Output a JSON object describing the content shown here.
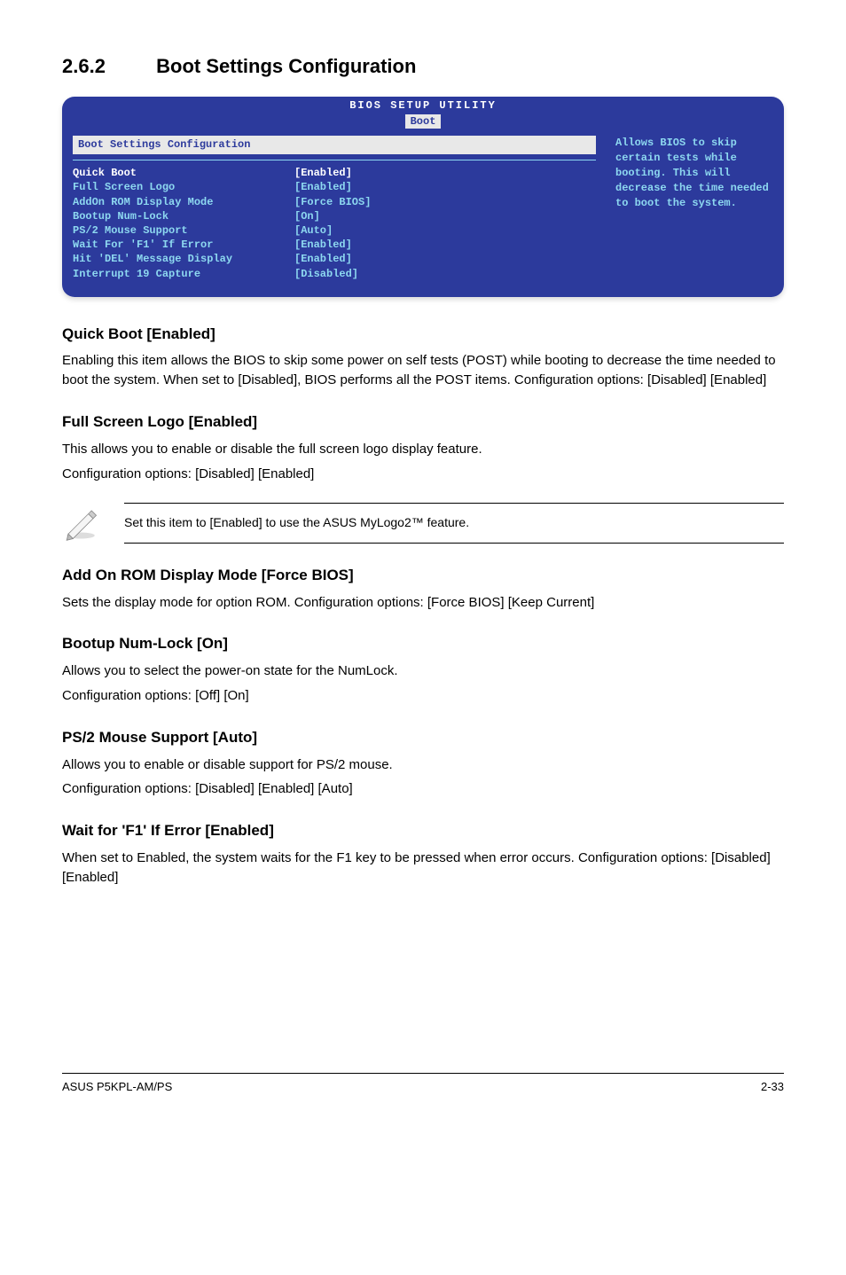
{
  "section": {
    "number": "2.6.2",
    "title": "Boot Settings Configuration"
  },
  "bios": {
    "utility_title": "BIOS SETUP UTILITY",
    "tab": "Boot",
    "panel_title": "Boot Settings Configuration",
    "rows": [
      {
        "label": "Quick Boot",
        "value": "[Enabled]",
        "selected": true
      },
      {
        "label": "Full Screen Logo",
        "value": "[Enabled]",
        "selected": false
      },
      {
        "label": "AddOn ROM Display Mode",
        "value": "[Force BIOS]",
        "selected": false
      },
      {
        "label": "Bootup Num-Lock",
        "value": "[On]",
        "selected": false
      },
      {
        "label": "PS/2 Mouse Support",
        "value": "[Auto]",
        "selected": false
      },
      {
        "label": "Wait For 'F1' If Error",
        "value": "[Enabled]",
        "selected": false
      },
      {
        "label": "Hit 'DEL' Message Display",
        "value": "[Enabled]",
        "selected": false
      },
      {
        "label": "Interrupt 19 Capture",
        "value": "[Disabled]",
        "selected": false
      }
    ],
    "help_text": "Allows BIOS to skip certain tests while booting. This will decrease the time needed to boot the system."
  },
  "subsections": {
    "quick_boot": {
      "title": "Quick Boot [Enabled]",
      "body": "Enabling this item allows the BIOS to skip some power on self tests (POST) while booting to decrease the time needed to boot the system. When set to [Disabled], BIOS performs all the POST items. Configuration options: [Disabled] [Enabled]"
    },
    "full_screen": {
      "title": "Full Screen Logo [Enabled]",
      "body1": "This allows you to enable or disable the full screen logo display feature.",
      "body2": "Configuration options: [Disabled] [Enabled]"
    },
    "note": "Set this item to [Enabled] to use the ASUS MyLogo2™ feature.",
    "addon_rom": {
      "title": "Add On ROM Display Mode [Force BIOS]",
      "body": "Sets the display mode for option ROM. Configuration options: [Force BIOS] [Keep Current]"
    },
    "bootup_numlock": {
      "title": "Bootup Num-Lock [On]",
      "body1": "Allows you to select the power-on state for the NumLock.",
      "body2": "Configuration options: [Off] [On]"
    },
    "ps2": {
      "title": "PS/2 Mouse Support [Auto]",
      "body1": "Allows you to enable or disable support for PS/2 mouse.",
      "body2": "Configuration options: [Disabled] [Enabled] [Auto]"
    },
    "wait_f1": {
      "title": "Wait for 'F1' If Error [Enabled]",
      "body": "When set to Enabled, the system waits for the F1 key to be pressed when error occurs. Configuration options: [Disabled] [Enabled]"
    }
  },
  "footer": {
    "left": "ASUS P5KPL-AM/PS",
    "right": "2-33"
  }
}
